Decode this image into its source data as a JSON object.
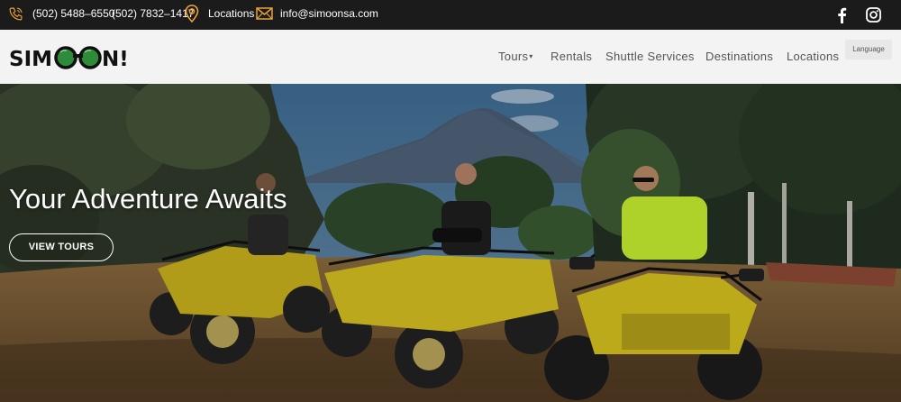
{
  "topbar": {
    "phone_1": "(502) 5488–6550",
    "phone_2": "(502) 7832–1417",
    "locations": "Locations",
    "email": "info@simoonsa.com",
    "icons": [
      "phone-icon",
      "map-pin-icon",
      "mail-icon",
      "facebook-icon",
      "instagram-icon"
    ],
    "icon_color": "#e8a33a"
  },
  "header": {
    "logo_text": "SIMOON!",
    "nav": {
      "tours": "Tours",
      "rentals": "Rentals",
      "shuttle": "Shuttle Services",
      "destinations": "Destinations",
      "locations": "Locations"
    },
    "language": "Language"
  },
  "hero": {
    "title": "Your Adventure Awaits",
    "cta": "VIEW TOURS"
  },
  "colors": {
    "topbar_bg": "#1b1b1b",
    "header_bg": "#f3f3f3",
    "logo_green": "#2e8b3a",
    "atv_yellow": "#d8c21e"
  }
}
